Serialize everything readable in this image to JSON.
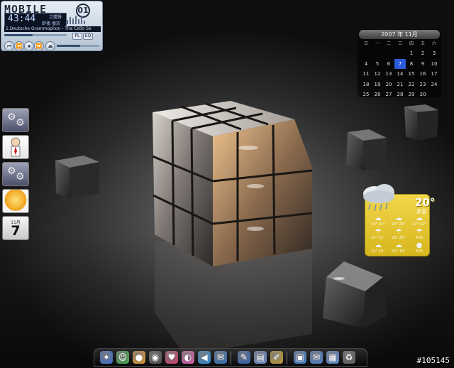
{
  "player": {
    "logo": "MOBILE",
    "logo_circle": "01",
    "time": "43:44",
    "status_top": "立體聲",
    "status_bottom": "即播  播放",
    "track": "1.Deutsche Grammophon - The Cello Se",
    "mini_buttons": [
      "PL",
      "EQ"
    ],
    "seek_fraction": 0.45,
    "volume_fraction": 0.55,
    "controls": [
      "⏮",
      "⏪",
      "⏹",
      "⏩",
      "⏏"
    ]
  },
  "calendar": {
    "header": "2007 年 11月",
    "weekdays": [
      "日",
      "一",
      "二",
      "三",
      "四",
      "五",
      "六"
    ],
    "weeks": [
      [
        "",
        "",
        "",
        "",
        "1",
        "2",
        "3"
      ],
      [
        "4",
        "5",
        "6",
        "7",
        "8",
        "9",
        "10"
      ],
      [
        "11",
        "12",
        "13",
        "14",
        "15",
        "16",
        "17"
      ],
      [
        "18",
        "19",
        "20",
        "21",
        "22",
        "23",
        "24"
      ],
      [
        "25",
        "26",
        "27",
        "28",
        "29",
        "30",
        ""
      ]
    ],
    "today": "7"
  },
  "left_dock": {
    "items": [
      {
        "name": "gadget-settings-icon"
      },
      {
        "name": "dilbert-comic-icon"
      },
      {
        "name": "gadget-settings-icon-2"
      },
      {
        "name": "weather-icon"
      },
      {
        "name": "date-icon",
        "month": "11月",
        "day": "7"
      }
    ]
  },
  "weather": {
    "temp": "20°",
    "now_label": "多雲",
    "forecast": [
      {
        "temp": "25°  21°"
      },
      {
        "temp": "21°  21°"
      },
      {
        "temp": "22°  21°"
      },
      {
        "temp": "22°  21°"
      },
      {
        "temp": "21°  21°"
      },
      {
        "temp": "55%"
      },
      {
        "temp": "22°  15°"
      },
      {
        "temp": "21°  15°"
      },
      {
        "temp": "55%"
      }
    ]
  },
  "dock": {
    "icons": [
      "wizard-icon",
      "users-icon",
      "pumpkin-icon",
      "media-player-icon",
      "lips-icon",
      "color-wheel-icon",
      "back-arrow-icon",
      "outlook-express-icon",
      "tools-icon",
      "notepad-icon",
      "brushes-icon",
      "network-icon",
      "mail-icon",
      "folder-icon",
      "trash-icon"
    ]
  },
  "watermark": "#105145"
}
